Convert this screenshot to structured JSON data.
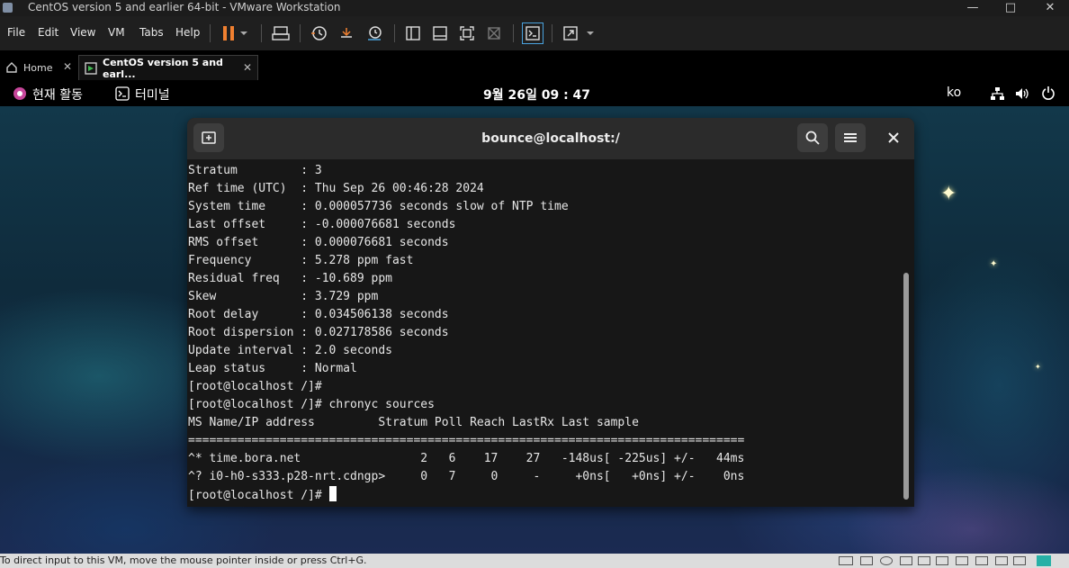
{
  "window": {
    "title": "CentOS version 5 and earlier 64-bit - VMware Workstation"
  },
  "menu": {
    "items": [
      "File",
      "Edit",
      "View",
      "VM",
      "Tabs",
      "Help"
    ]
  },
  "tabs": [
    {
      "label": "Home"
    },
    {
      "label": "CentOS version 5 and earl..."
    }
  ],
  "gnome": {
    "activities": "현재 활동",
    "app": "터미널",
    "clock": "9월 26일  09 : 47",
    "input_lang": "ko"
  },
  "terminal": {
    "title": "bounce@localhost:/",
    "lines": [
      "Stratum         : 3",
      "Ref time (UTC)  : Thu Sep 26 00:46:28 2024",
      "System time     : 0.000057736 seconds slow of NTP time",
      "Last offset     : -0.000076681 seconds",
      "RMS offset      : 0.000076681 seconds",
      "Frequency       : 5.278 ppm fast",
      "Residual freq   : -10.689 ppm",
      "Skew            : 3.729 ppm",
      "Root delay      : 0.034506138 seconds",
      "Root dispersion : 0.027178586 seconds",
      "Update interval : 2.0 seconds",
      "Leap status     : Normal",
      "[root@localhost /]#",
      "[root@localhost /]# chronyc sources",
      "MS Name/IP address         Stratum Poll Reach LastRx Last sample",
      "===============================================================================",
      "^* time.bora.net                 2   6    17    27   -148us[ -225us] +/-   44ms",
      "^? i0-h0-s333.p28-nrt.cdngp>     0   7     0     -     +0ns[   +0ns] +/-    0ns"
    ],
    "prompt": "[root@localhost /]# "
  },
  "statusbar": {
    "text": "To direct input to this VM, move the mouse pointer inside or press Ctrl+G."
  },
  "colors": {
    "accent_orange": "#f08030",
    "terminal_bg": "#171717",
    "header_bg": "#2b2b2b"
  }
}
